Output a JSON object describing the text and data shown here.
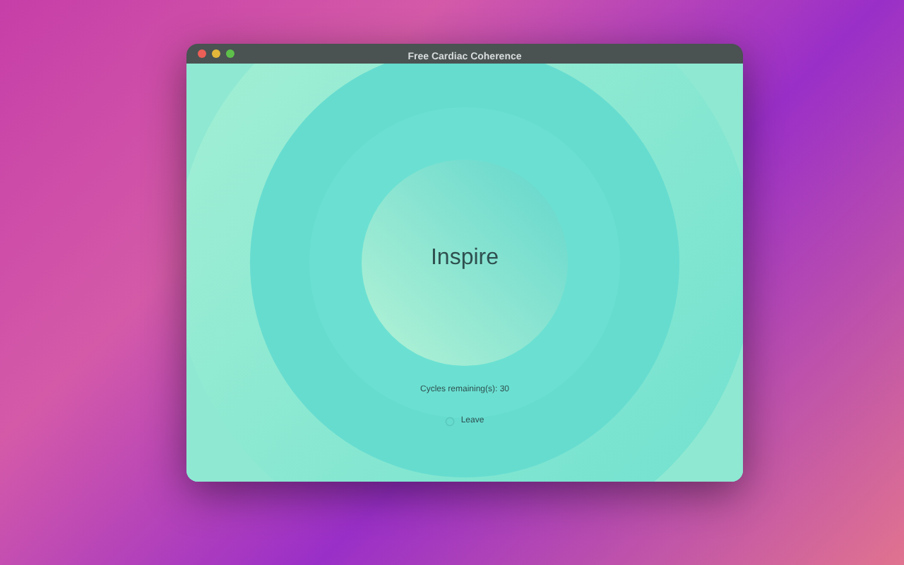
{
  "window": {
    "title": "Free Cardiac Coherence"
  },
  "breath": {
    "label": "Inspire"
  },
  "cycles": {
    "text": "Cycles remaining(s): 30"
  },
  "leave_button": {
    "label": "Leave"
  }
}
